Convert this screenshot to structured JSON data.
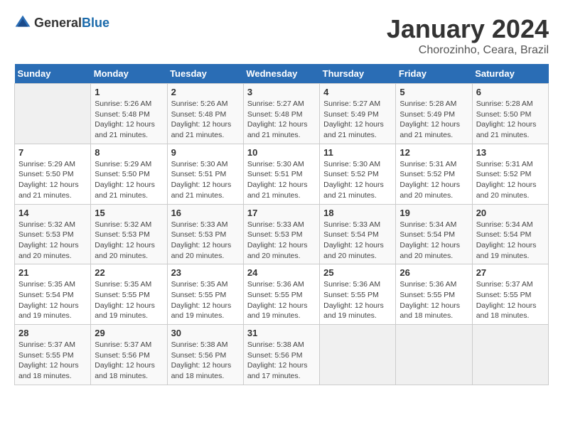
{
  "header": {
    "logo_general": "General",
    "logo_blue": "Blue",
    "title": "January 2024",
    "location": "Chorozinho, Ceara, Brazil"
  },
  "days_of_week": [
    "Sunday",
    "Monday",
    "Tuesday",
    "Wednesday",
    "Thursday",
    "Friday",
    "Saturday"
  ],
  "weeks": [
    [
      {
        "day": "",
        "info": ""
      },
      {
        "day": "1",
        "info": "Sunrise: 5:26 AM\nSunset: 5:48 PM\nDaylight: 12 hours\nand 21 minutes."
      },
      {
        "day": "2",
        "info": "Sunrise: 5:26 AM\nSunset: 5:48 PM\nDaylight: 12 hours\nand 21 minutes."
      },
      {
        "day": "3",
        "info": "Sunrise: 5:27 AM\nSunset: 5:48 PM\nDaylight: 12 hours\nand 21 minutes."
      },
      {
        "day": "4",
        "info": "Sunrise: 5:27 AM\nSunset: 5:49 PM\nDaylight: 12 hours\nand 21 minutes."
      },
      {
        "day": "5",
        "info": "Sunrise: 5:28 AM\nSunset: 5:49 PM\nDaylight: 12 hours\nand 21 minutes."
      },
      {
        "day": "6",
        "info": "Sunrise: 5:28 AM\nSunset: 5:50 PM\nDaylight: 12 hours\nand 21 minutes."
      }
    ],
    [
      {
        "day": "7",
        "info": "Sunrise: 5:29 AM\nSunset: 5:50 PM\nDaylight: 12 hours\nand 21 minutes."
      },
      {
        "day": "8",
        "info": "Sunrise: 5:29 AM\nSunset: 5:50 PM\nDaylight: 12 hours\nand 21 minutes."
      },
      {
        "day": "9",
        "info": "Sunrise: 5:30 AM\nSunset: 5:51 PM\nDaylight: 12 hours\nand 21 minutes."
      },
      {
        "day": "10",
        "info": "Sunrise: 5:30 AM\nSunset: 5:51 PM\nDaylight: 12 hours\nand 21 minutes."
      },
      {
        "day": "11",
        "info": "Sunrise: 5:30 AM\nSunset: 5:52 PM\nDaylight: 12 hours\nand 21 minutes."
      },
      {
        "day": "12",
        "info": "Sunrise: 5:31 AM\nSunset: 5:52 PM\nDaylight: 12 hours\nand 20 minutes."
      },
      {
        "day": "13",
        "info": "Sunrise: 5:31 AM\nSunset: 5:52 PM\nDaylight: 12 hours\nand 20 minutes."
      }
    ],
    [
      {
        "day": "14",
        "info": "Sunrise: 5:32 AM\nSunset: 5:53 PM\nDaylight: 12 hours\nand 20 minutes."
      },
      {
        "day": "15",
        "info": "Sunrise: 5:32 AM\nSunset: 5:53 PM\nDaylight: 12 hours\nand 20 minutes."
      },
      {
        "day": "16",
        "info": "Sunrise: 5:33 AM\nSunset: 5:53 PM\nDaylight: 12 hours\nand 20 minutes."
      },
      {
        "day": "17",
        "info": "Sunrise: 5:33 AM\nSunset: 5:53 PM\nDaylight: 12 hours\nand 20 minutes."
      },
      {
        "day": "18",
        "info": "Sunrise: 5:33 AM\nSunset: 5:54 PM\nDaylight: 12 hours\nand 20 minutes."
      },
      {
        "day": "19",
        "info": "Sunrise: 5:34 AM\nSunset: 5:54 PM\nDaylight: 12 hours\nand 20 minutes."
      },
      {
        "day": "20",
        "info": "Sunrise: 5:34 AM\nSunset: 5:54 PM\nDaylight: 12 hours\nand 19 minutes."
      }
    ],
    [
      {
        "day": "21",
        "info": "Sunrise: 5:35 AM\nSunset: 5:54 PM\nDaylight: 12 hours\nand 19 minutes."
      },
      {
        "day": "22",
        "info": "Sunrise: 5:35 AM\nSunset: 5:55 PM\nDaylight: 12 hours\nand 19 minutes."
      },
      {
        "day": "23",
        "info": "Sunrise: 5:35 AM\nSunset: 5:55 PM\nDaylight: 12 hours\nand 19 minutes."
      },
      {
        "day": "24",
        "info": "Sunrise: 5:36 AM\nSunset: 5:55 PM\nDaylight: 12 hours\nand 19 minutes."
      },
      {
        "day": "25",
        "info": "Sunrise: 5:36 AM\nSunset: 5:55 PM\nDaylight: 12 hours\nand 19 minutes."
      },
      {
        "day": "26",
        "info": "Sunrise: 5:36 AM\nSunset: 5:55 PM\nDaylight: 12 hours\nand 18 minutes."
      },
      {
        "day": "27",
        "info": "Sunrise: 5:37 AM\nSunset: 5:55 PM\nDaylight: 12 hours\nand 18 minutes."
      }
    ],
    [
      {
        "day": "28",
        "info": "Sunrise: 5:37 AM\nSunset: 5:55 PM\nDaylight: 12 hours\nand 18 minutes."
      },
      {
        "day": "29",
        "info": "Sunrise: 5:37 AM\nSunset: 5:56 PM\nDaylight: 12 hours\nand 18 minutes."
      },
      {
        "day": "30",
        "info": "Sunrise: 5:38 AM\nSunset: 5:56 PM\nDaylight: 12 hours\nand 18 minutes."
      },
      {
        "day": "31",
        "info": "Sunrise: 5:38 AM\nSunset: 5:56 PM\nDaylight: 12 hours\nand 17 minutes."
      },
      {
        "day": "",
        "info": ""
      },
      {
        "day": "",
        "info": ""
      },
      {
        "day": "",
        "info": ""
      }
    ]
  ]
}
